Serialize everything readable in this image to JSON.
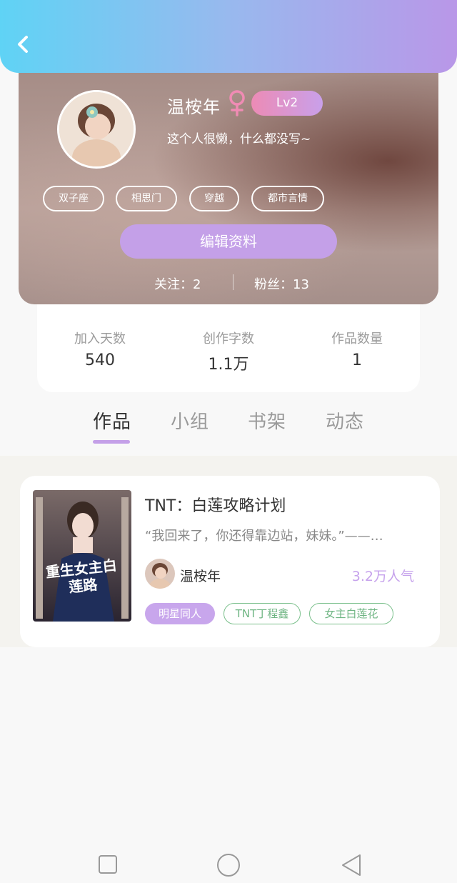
{
  "profile": {
    "username": "温桉年",
    "level": "Lv2",
    "bio": "这个人很懒，什么都没写~",
    "tags": [
      "双子座",
      "相思门",
      "穿越",
      "都市言情"
    ],
    "edit_label": "编辑资料",
    "following": "关注：2",
    "fans": "粉丝：13"
  },
  "stats": [
    {
      "label": "加入天数",
      "value": "540"
    },
    {
      "label": "创作字数",
      "value": "1.1万"
    },
    {
      "label": "作品数量",
      "value": "1"
    }
  ],
  "tabs": [
    "作品",
    "小组",
    "书架",
    "动态"
  ],
  "active_tab": "作品",
  "work": {
    "title": "TNT：白莲攻略计划",
    "excerpt": "“我回来了，你还得靠边站，妹妹。”——…",
    "author": "温桉年",
    "popularity": "3.2万人气",
    "tags": [
      "明星同人",
      "TNT丁程鑫",
      "女主白莲花"
    ],
    "cover_text": "重生女主白莲路"
  },
  "colors": {
    "accent_purple": "#c4a0e8",
    "gender_pink": "#f08bb4",
    "tag_green": "#7bc08c"
  },
  "icons": {
    "back": "chevron-left-icon",
    "gender": "female-icon",
    "nav_square": "square-icon",
    "nav_home": "circle-icon",
    "nav_back": "triangle-back-icon"
  }
}
